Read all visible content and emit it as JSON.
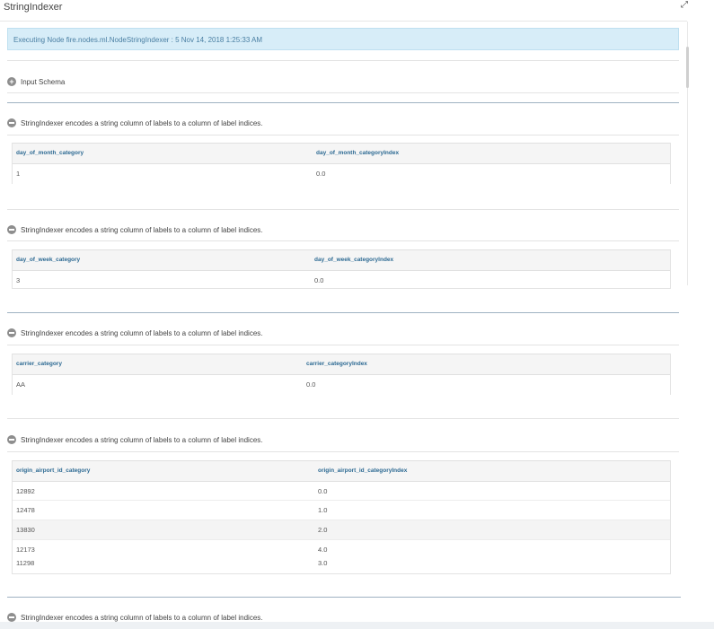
{
  "window": {
    "title": "StringIndexer",
    "expand_icon": "expand-arrows-icon"
  },
  "alert": {
    "text": "Executing Node fire.nodes.ml.NodeStringIndexer : 5 Nov 14, 2018 1:25:33 AM"
  },
  "input_schema": {
    "label": "Input Schema",
    "icon": "plus-circle-icon"
  },
  "sections": [
    {
      "description": "StringIndexer encodes a string column of labels to a column of label indices.",
      "columns": [
        "day_of_month_category",
        "day_of_month_categoryIndex"
      ],
      "rows": [
        [
          "1",
          "0.0"
        ]
      ]
    },
    {
      "description": "StringIndexer encodes a string column of labels to a column of label indices.",
      "columns": [
        "day_of_week_category",
        "day_of_week_categoryIndex"
      ],
      "rows": [
        [
          "3",
          "0.0"
        ]
      ]
    },
    {
      "description": "StringIndexer encodes a string column of labels to a column of label indices.",
      "columns": [
        "carrier_category",
        "carrier_categoryIndex"
      ],
      "rows": [
        [
          "AA",
          "0.0"
        ]
      ]
    },
    {
      "description": "StringIndexer encodes a string column of labels to a column of label indices.",
      "columns": [
        "origin_airport_id_category",
        "origin_airport_id_categoryIndex"
      ],
      "rows": [
        [
          "12892",
          "0.0"
        ],
        [
          "12478",
          "1.0"
        ],
        [
          "13830",
          "2.0"
        ],
        [
          "12173",
          "4.0"
        ],
        [
          "11298",
          "3.0"
        ]
      ]
    },
    {
      "description": "StringIndexer encodes a string column of labels to a column of label indices."
    }
  ]
}
